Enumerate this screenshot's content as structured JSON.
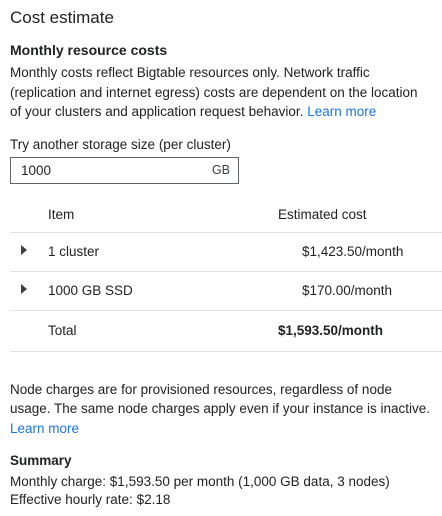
{
  "panel": {
    "title": "Cost estimate"
  },
  "monthly": {
    "heading": "Monthly resource costs",
    "description": "Monthly costs reflect Bigtable resources only. Network traffic (replication and internet egress) costs are dependent on the location of your clusters and application request behavior.",
    "learn_more": "Learn more"
  },
  "storage": {
    "label": "Try another storage size (per cluster)",
    "value": "1000",
    "unit": "GB"
  },
  "table": {
    "headers": {
      "item": "Item",
      "cost": "Estimated cost"
    },
    "rows": [
      {
        "item": "1 cluster",
        "cost": "$1,423.50/month",
        "expander_icon": "chevron-right-icon"
      },
      {
        "item": "1000 GB SSD",
        "cost": "$170.00/month",
        "expander_icon": "chevron-right-icon"
      }
    ],
    "total": {
      "item": "Total",
      "cost": "$1,593.50/month"
    }
  },
  "node_charges": {
    "text": "Node charges are for provisioned resources, regardless of node usage. The same node charges apply even if your instance is inactive.",
    "learn_more": "Learn more"
  },
  "summary": {
    "heading": "Summary",
    "monthly_charge": "Monthly charge: $1,593.50 per month (1,000 GB data, 3 nodes)",
    "hourly_rate": "Effective hourly rate: $2.18"
  },
  "colors": {
    "link": "#1a73e8",
    "text": "#202124",
    "divider": "#e0e0e0"
  }
}
